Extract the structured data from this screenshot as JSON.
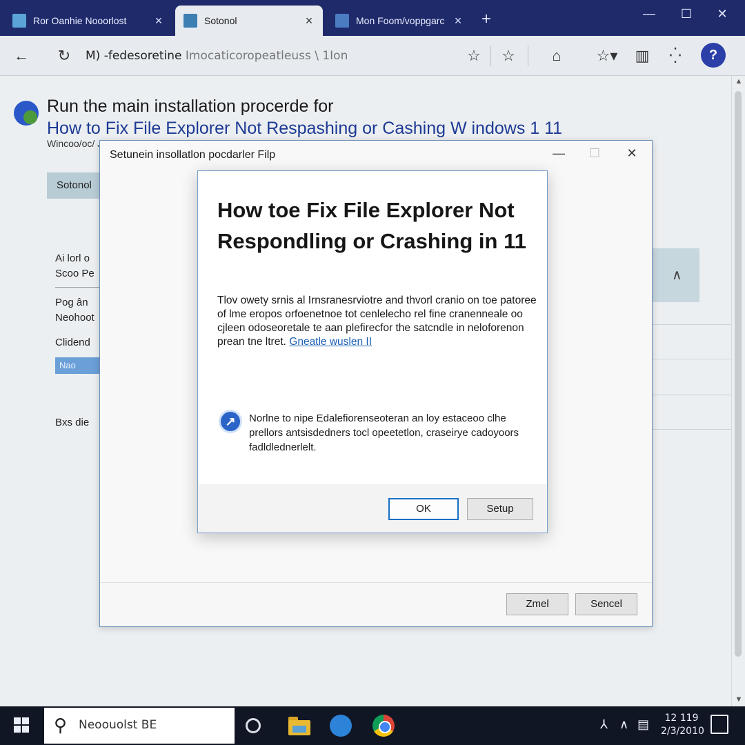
{
  "browser": {
    "tabs": [
      {
        "title": "Ror Oanhie Nooorlost",
        "close": "×",
        "active": false
      },
      {
        "title": "Sotonol",
        "close": "×",
        "active": true
      },
      {
        "title": "Mon Foom/voppgarc",
        "close": "×",
        "active": false
      }
    ],
    "new_tab": "+",
    "window_controls": {
      "minimize": "—",
      "maximize": "☐",
      "close": "✕"
    },
    "toolbar": {
      "back": "←",
      "reload": "↻",
      "address_main": "M) -fedesoretine",
      "address_rest": "Imocaticoropeatleuss \\ 1Ion",
      "icons": [
        "share-star-icon",
        "favorite-icon",
        "home-icon",
        "favorites-icon",
        "collections-icon",
        "more-icon"
      ],
      "help": "?"
    }
  },
  "page": {
    "heading": "Run the main installation procerde for",
    "link_heading": "How to Fix File Explorer Not Respashing or Cashing W indows 1 11",
    "subtitle": "Wincoo/oc/ J",
    "button": "Sotonol",
    "side_items": [
      "Ai lorl o",
      "Scoo Pe",
      "Pog ân",
      "Neohoot",
      "Clidend",
      "Bxs die"
    ],
    "side_selected": "Nao"
  },
  "outer_dialog": {
    "title": "Setunein insollatlon pocdarler Filp",
    "controls": {
      "minimize": "—",
      "maximize": "☐",
      "close": "✕"
    },
    "btn_left": "Zmel",
    "btn_right": "Sencel"
  },
  "inner_dialog": {
    "title": "How toe Fix File Explorer Not Respondling or Crashing in 11",
    "body": "Tlov owety srnis al Irnsranesrviotre and thvorl cranio on toe patoree of lme eropos orfoenetnoe tot cenlelecho rel fine cranenneale oo cjleen odoseoretale te aan plefirecfor the satcndle in neloforenon prean tne ltret.",
    "body_link": "Gneatle wuslen II",
    "note": "Norlne to nipe Edalefiorenseoteran an loy estaceoo clhe prellors antsisdedners tocl opeetetlon, craseirye cadoyoors fadldlednerlelt.",
    "btn_ok": "OK",
    "btn_setup": "Setup"
  },
  "taskbar": {
    "search_text": "Neoouolst BE",
    "clock_time": "12 119",
    "clock_date": "2/3/2010"
  }
}
